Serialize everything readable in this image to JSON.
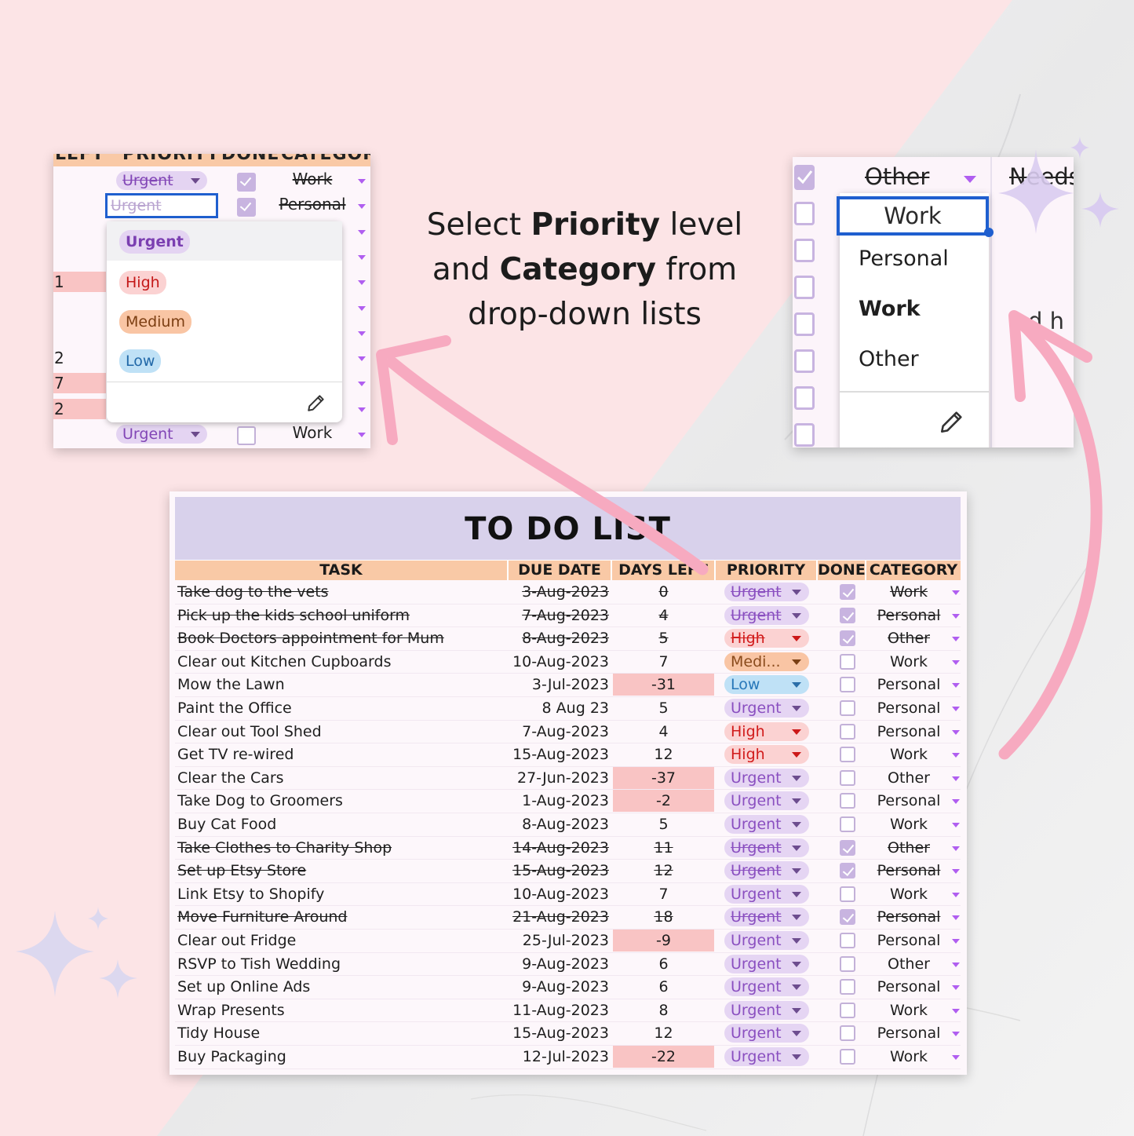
{
  "headline": {
    "line1_pre": "Select ",
    "line1_bold": "Priority",
    "line1_post": " level",
    "line2_pre": "and ",
    "line2_bold": "Category",
    "line2_post": " from",
    "line3": "drop-down lists"
  },
  "zoom_left": {
    "header_labels": [
      "LEFT",
      "PRIORITY",
      "DONE",
      "CATEGORY"
    ],
    "rows": [
      {
        "days": "",
        "priority": "Urgent",
        "done": true,
        "category": "Work",
        "strike": true
      },
      {
        "days": "",
        "priority": "",
        "done": true,
        "category": "Personal",
        "strike": true
      },
      {
        "days": "",
        "category": ""
      },
      {
        "days": "",
        "category": ""
      },
      {
        "days": "1",
        "neg": true,
        "category": ""
      },
      {
        "days": "",
        "category": ""
      },
      {
        "days": "",
        "category": ""
      },
      {
        "days": "2",
        "category": ""
      },
      {
        "days": "7",
        "neg": true,
        "category": ""
      },
      {
        "days": "2",
        "neg": true,
        "category": ""
      },
      {
        "days": "",
        "priority": "Urgent",
        "done": false,
        "category": "Work",
        "strike": false
      }
    ],
    "edit_value": "Urgent",
    "dropdown_options": [
      "Urgent",
      "High",
      "Medium",
      "Low"
    ],
    "edit_icon": "pencil-icon"
  },
  "zoom_right": {
    "top_value": "Other",
    "top_partial": "Needs",
    "partial_right": "d h",
    "edit_value": "Work",
    "dropdown_options": [
      "Personal",
      "Work",
      "Other"
    ],
    "edit_icon": "pencil-icon"
  },
  "sheet": {
    "title": "TO DO LIST",
    "columns": [
      "TASK",
      "DUE DATE",
      "DAYS LEFT",
      "PRIORITY",
      "DONE",
      "CATEGORY"
    ],
    "rows": [
      {
        "task": "Take dog to the vets",
        "due": "3-Aug-2023",
        "days": "0",
        "priority": "Urgent",
        "done": true,
        "category": "Work"
      },
      {
        "task": "Pick up the kids school uniform ",
        "due": "7-Aug-2023",
        "days": "4",
        "priority": "Urgent",
        "done": true,
        "category": "Personal"
      },
      {
        "task": "Book Doctors appointment for Mum",
        "due": "8-Aug-2023",
        "days": "5",
        "priority": "High",
        "done": true,
        "category": "Other"
      },
      {
        "task": "Clear out Kitchen Cupboards",
        "due": "10-Aug-2023",
        "days": "7",
        "priority": "Medi...",
        "done": false,
        "category": "Work"
      },
      {
        "task": "Mow the Lawn",
        "due": "3-Jul-2023",
        "days": "-31",
        "priority": "Low",
        "done": false,
        "category": "Personal"
      },
      {
        "task": "Paint the Office",
        "due": "8 Aug 23",
        "days": "5",
        "priority": "Urgent",
        "done": false,
        "category": "Personal"
      },
      {
        "task": "Clear out Tool Shed",
        "due": "7-Aug-2023",
        "days": "4",
        "priority": "High",
        "done": false,
        "category": "Personal"
      },
      {
        "task": "Get TV re-wired",
        "due": "15-Aug-2023",
        "days": "12",
        "priority": "High",
        "done": false,
        "category": "Work"
      },
      {
        "task": "Clear the Cars",
        "due": "27-Jun-2023",
        "days": "-37",
        "priority": "Urgent",
        "done": false,
        "category": "Other"
      },
      {
        "task": "Take Dog to Groomers",
        "due": "1-Aug-2023",
        "days": "-2",
        "priority": "Urgent",
        "done": false,
        "category": "Personal"
      },
      {
        "task": "Buy Cat Food",
        "due": "8-Aug-2023",
        "days": "5",
        "priority": "Urgent",
        "done": false,
        "category": "Work"
      },
      {
        "task": "Take Clothes to Charity Shop",
        "due": "14-Aug-2023",
        "days": "11",
        "priority": "Urgent",
        "done": true,
        "category": "Other"
      },
      {
        "task": "Set up Etsy Store",
        "due": "15-Aug-2023",
        "days": "12",
        "priority": "Urgent",
        "done": true,
        "category": "Personal"
      },
      {
        "task": "Link Etsy to Shopify",
        "due": "10-Aug-2023",
        "days": "7",
        "priority": "Urgent",
        "done": false,
        "category": "Work"
      },
      {
        "task": "Move Furniture Around",
        "due": "21-Aug-2023",
        "days": "18",
        "priority": "Urgent",
        "done": true,
        "category": "Personal"
      },
      {
        "task": "Clear out Fridge",
        "due": "25-Jul-2023",
        "days": "-9",
        "priority": "Urgent",
        "done": false,
        "category": "Personal"
      },
      {
        "task": "RSVP to Tish Wedding",
        "due": "9-Aug-2023",
        "days": "6",
        "priority": "Urgent",
        "done": false,
        "category": "Other"
      },
      {
        "task": "Set up Online Ads",
        "due": "9-Aug-2023",
        "days": "6",
        "priority": "Urgent",
        "done": false,
        "category": "Personal"
      },
      {
        "task": "Wrap Presents",
        "due": "11-Aug-2023",
        "days": "8",
        "priority": "Urgent",
        "done": false,
        "category": "Work"
      },
      {
        "task": "Tidy House",
        "due": "15-Aug-2023",
        "days": "12",
        "priority": "Urgent",
        "done": false,
        "category": "Personal"
      },
      {
        "task": "Buy Packaging",
        "due": "12-Jul-2023",
        "days": "-22",
        "priority": "Urgent",
        "done": false,
        "category": "Work"
      }
    ]
  },
  "colors": {
    "background_pink": "#fce4e6",
    "header_peach": "#f9c9a6",
    "title_lavender": "#d8d1eb",
    "overdue_pink": "#f9c4c4",
    "arrow_pink": "#f7aac0",
    "selection_blue": "#1f5fcf"
  }
}
